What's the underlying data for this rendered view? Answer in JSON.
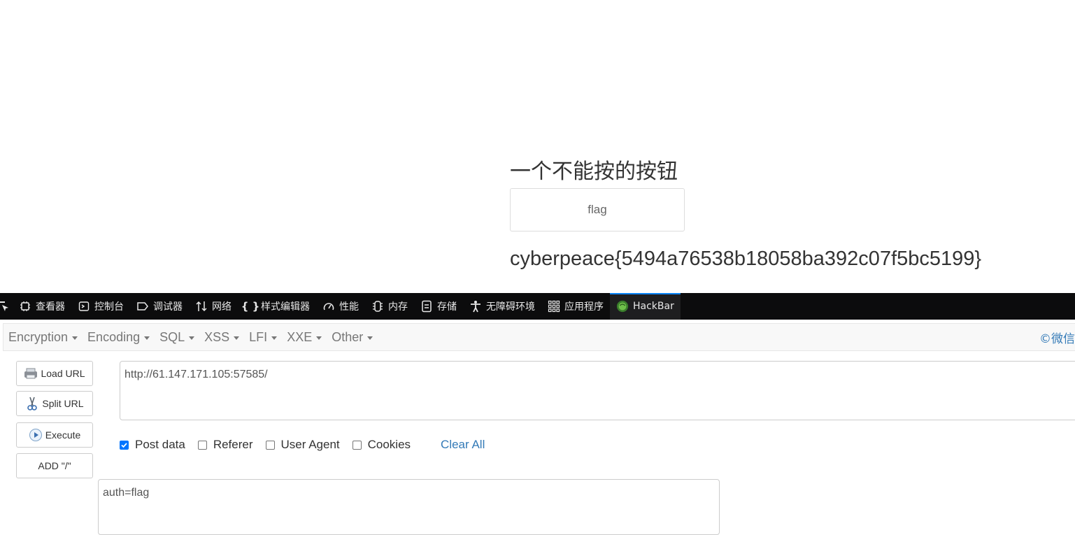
{
  "page": {
    "title": "一个不能按的按钮",
    "button_label": "flag",
    "result": "cyberpeace{5494a76538b18058ba392c07f5bc5199}"
  },
  "devtools": {
    "tabs": [
      {
        "label": "查看器",
        "icon": "inspector-icon"
      },
      {
        "label": "控制台",
        "icon": "console-icon"
      },
      {
        "label": "调试器",
        "icon": "debugger-icon"
      },
      {
        "label": "网络",
        "icon": "network-icon"
      },
      {
        "label": "样式编辑器",
        "icon": "style-editor-icon"
      },
      {
        "label": "性能",
        "icon": "performance-icon"
      },
      {
        "label": "内存",
        "icon": "memory-icon"
      },
      {
        "label": "存储",
        "icon": "storage-icon"
      },
      {
        "label": "无障碍环境",
        "icon": "accessibility-icon"
      },
      {
        "label": "应用程序",
        "icon": "application-icon"
      },
      {
        "label": "HackBar",
        "icon": "hackbar-icon",
        "active": true
      }
    ],
    "active_color": "#0a84ff"
  },
  "hackbar": {
    "menu": [
      {
        "label": "Encryption"
      },
      {
        "label": "Encoding"
      },
      {
        "label": "SQL"
      },
      {
        "label": "XSS"
      },
      {
        "label": "LFI"
      },
      {
        "label": "XXE"
      },
      {
        "label": "Other"
      }
    ],
    "credit": "©微信",
    "buttons": {
      "load_url": "Load URL",
      "split_url": "Split URL",
      "execute": "Execute",
      "add_slash": "ADD \"/\""
    },
    "url": "http://61.147.171.105:57585/",
    "options": {
      "post_data": {
        "label": "Post data",
        "checked": true
      },
      "referer": {
        "label": "Referer",
        "checked": false
      },
      "user_agent": {
        "label": "User Agent",
        "checked": false
      },
      "cookies": {
        "label": "Cookies",
        "checked": false
      }
    },
    "clear_all": "Clear All",
    "post_body": "auth=flag"
  }
}
